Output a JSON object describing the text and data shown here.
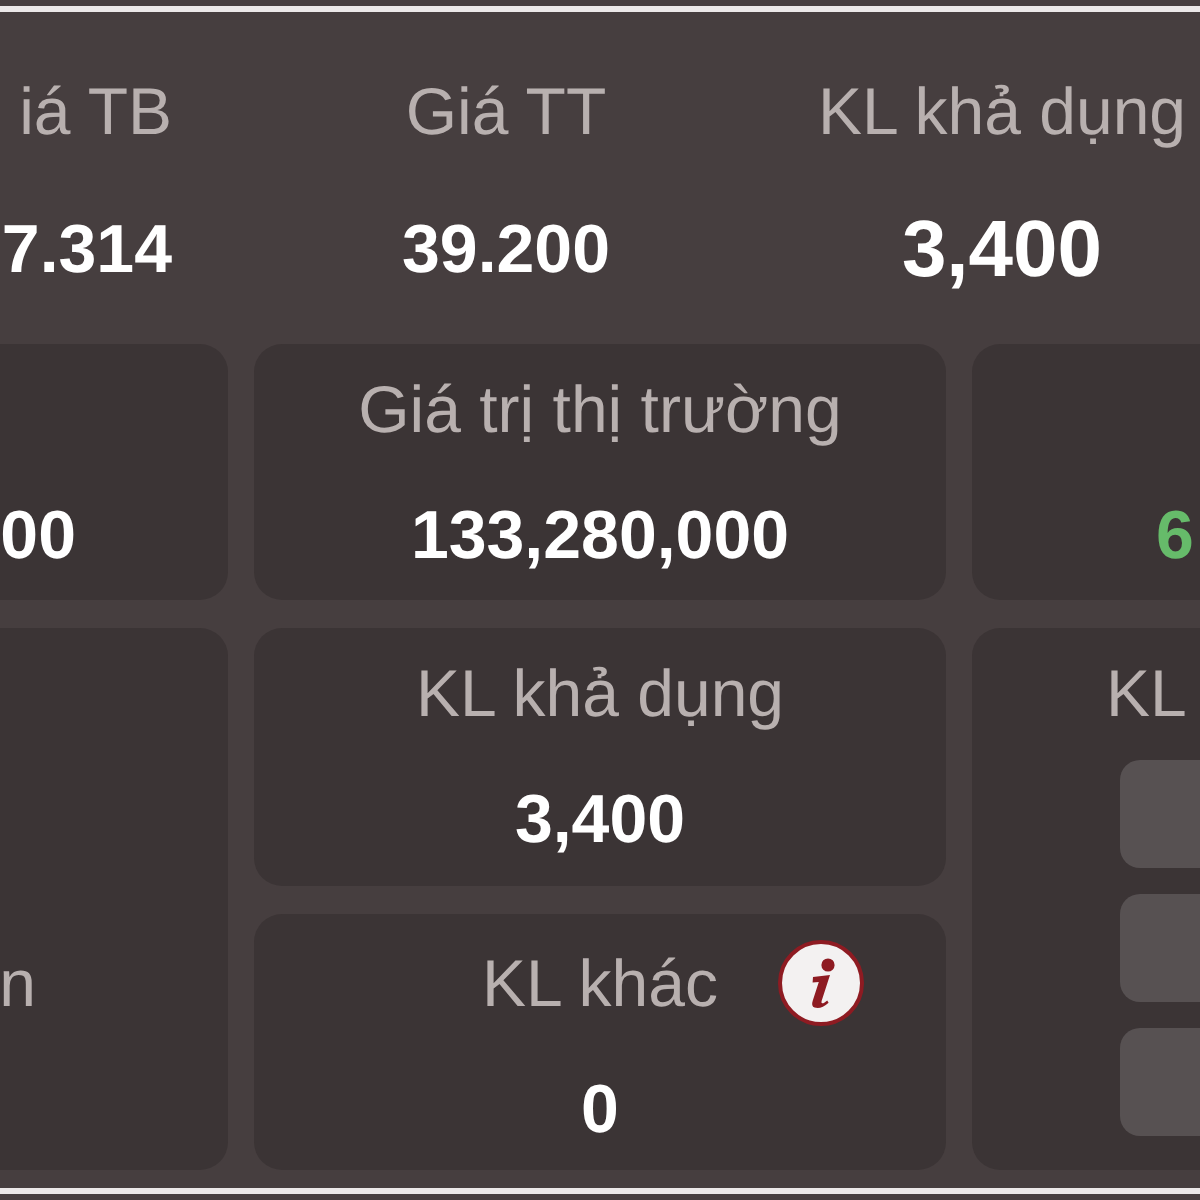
{
  "summary": [
    {
      "label": "iá TB",
      "value": "7.314",
      "kind": "normal"
    },
    {
      "label": "Giá TT",
      "value": "39.200",
      "kind": "normal"
    },
    {
      "label": "KL khả dụng",
      "value": "3,400",
      "kind": "large"
    }
  ],
  "left_cards": [
    {
      "value": "00"
    },
    {
      "label": "n"
    }
  ],
  "middle_cards": [
    {
      "label": "Giá trị thị trường",
      "value": "133,280,000"
    },
    {
      "label": "KL khả dụng",
      "value": "3,400"
    },
    {
      "label": "KL khác",
      "value": "0",
      "info": true
    }
  ],
  "right_cards": [
    {
      "value": "6",
      "color": "#66bb6a"
    },
    {
      "label": "KL",
      "buttons": [
        {
          "kind": "option"
        },
        {
          "kind": "option"
        },
        {
          "kind": "option"
        }
      ]
    }
  ]
}
